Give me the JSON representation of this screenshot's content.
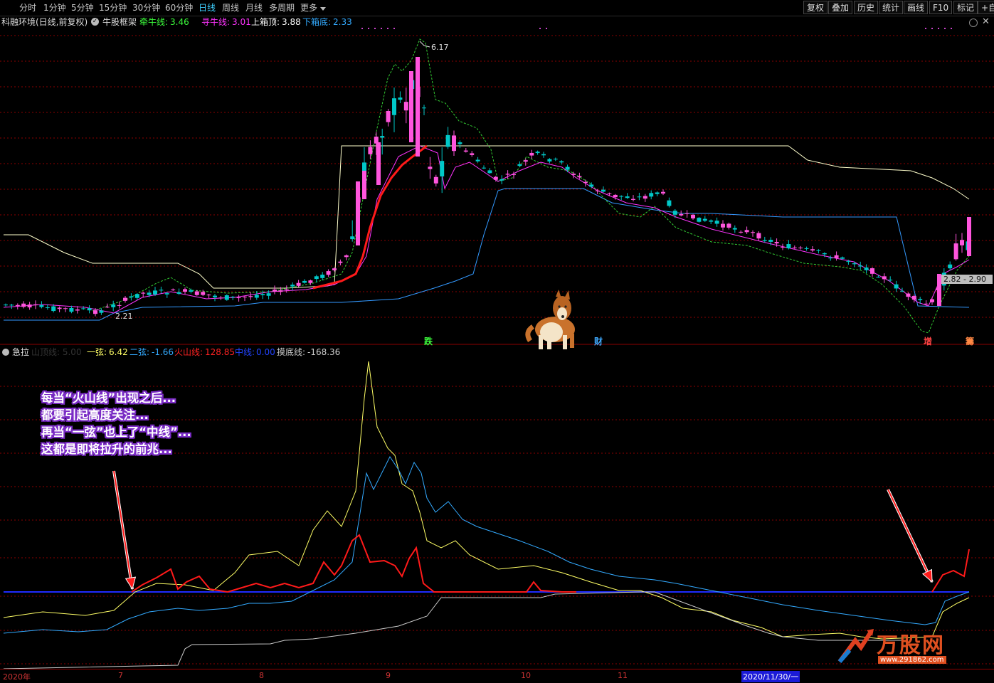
{
  "toolbar": {
    "timeframes": [
      "分时",
      "1分钟",
      "5分钟",
      "15分钟",
      "30分钟",
      "60分钟",
      "日线",
      "周线",
      "月线",
      "多周期",
      "更多"
    ],
    "active": "日线",
    "buttons": [
      "复权",
      "叠加",
      "历史",
      "统计",
      "画线",
      "F10",
      "标记",
      "+自选"
    ]
  },
  "main_panel": {
    "title": "科融环境(日线,前复权)",
    "indicator": "牛股框架",
    "values": [
      {
        "label": "牵牛线:",
        "value": "3.46",
        "color": "#3cff3c"
      },
      {
        "label": "寻牛线:",
        "value": "3.01",
        "color": "#ff33ff"
      },
      {
        "label": "上箱顶:",
        "value": "3.88",
        "color": "#ffffff"
      },
      {
        "label": "下箱底:",
        "value": "2.33",
        "color": "#33aaff"
      }
    ],
    "high_label": "6.17",
    "low_label": "2.21",
    "price_tag": "2.82 - 2.90",
    "signals": [
      {
        "text": "跌",
        "color": "#3cff3c"
      },
      {
        "text": "财",
        "color": "#3faaff"
      },
      {
        "text": "增",
        "color": "#ff4444"
      },
      {
        "text": "籌",
        "color": "#ff8844"
      }
    ]
  },
  "sub_panel": {
    "name": "急拉",
    "faded": "山顶线: 5.00",
    "values": [
      {
        "label": "一弦:",
        "value": "6.42",
        "color": "#ffff66"
      },
      {
        "label": "二弦:",
        "value": "-1.66",
        "color": "#33aaff"
      },
      {
        "label": "火山线:",
        "value": "128.85",
        "color": "#ff2222"
      },
      {
        "label": "中线:",
        "value": "0.00",
        "color": "#2222ff"
      },
      {
        "label": "摸底线:",
        "value": "-168.36",
        "color": "#cccccc"
      }
    ]
  },
  "callout": [
    "每当“火山线”出现之后...",
    "都要引起高度关注...",
    "再当“一弦”也上了“中线”...",
    "这都是即将拉升的前兆..."
  ],
  "xaxis": {
    "labels": [
      "2020年",
      "7",
      "8",
      "9",
      "10",
      "11",
      "2020/11/30/一"
    ],
    "selected": "2020/11/30/一"
  },
  "watermark": {
    "brand": "万股网",
    "url": "www.291862.com"
  },
  "colors": {
    "up": "#ff3333",
    "down": "#00c8c8",
    "candle_up_fill": "#ff55dd",
    "ma_main": "#ff1a1a",
    "upper_box": "#ffffcc",
    "lower_box": "#3399ff",
    "dashed_green": "#33cc33",
    "grid": "#8b0000"
  }
}
